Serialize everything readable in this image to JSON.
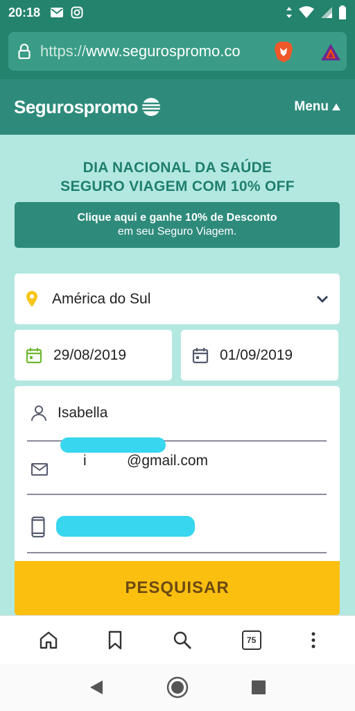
{
  "status_bar": {
    "time": "20:18"
  },
  "browser": {
    "url_scheme": "https://",
    "url_host": "www.segurospromo.co",
    "tab_count": "75"
  },
  "site": {
    "logo_text": "Segurospromo",
    "menu_label": "Menu"
  },
  "promo": {
    "title_line1": "DIA NACIONAL DA SAÚDE",
    "title_line2": "SEGURO VIAGEM COM 10% OFF",
    "banner_line1": "Clique aqui e ganhe 10% de Desconto",
    "banner_line2": "em seu Seguro Viagem."
  },
  "form": {
    "destination": "América do Sul",
    "date_start": "29/08/2019",
    "date_end": "01/09/2019",
    "name": "Isabella",
    "email_visible": "i          @gmail.com",
    "phone_visible": "(",
    "search_label": "PESQUISAR"
  },
  "colors": {
    "status_bar": "#23836d",
    "header": "#2e8b7b",
    "page_bg": "#b3e8e0",
    "accent_text": "#1f7f6e",
    "search_button": "#fbbf10",
    "redaction": "#38d6ef"
  },
  "icons": {
    "status": [
      "mail-icon",
      "instagram-icon",
      "wifi-icon",
      "signal-icon",
      "battery-icon"
    ],
    "form": [
      "location-pin-icon",
      "calendar-icon",
      "person-icon",
      "mail-icon",
      "phone-icon"
    ],
    "nav": [
      "home-icon",
      "bookmark-icon",
      "search-icon",
      "tabs-icon",
      "more-icon"
    ]
  }
}
